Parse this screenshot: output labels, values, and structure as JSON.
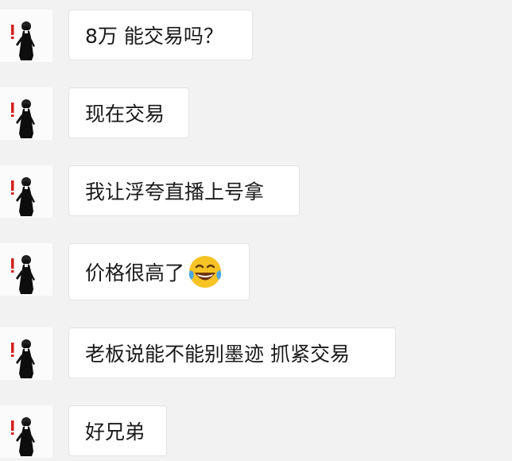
{
  "chat": {
    "messages": [
      {
        "text": "8万 能交易吗？",
        "avatar_icon": "black-robed-figure-icon"
      },
      {
        "text": "现在交易",
        "avatar_icon": "black-robed-figure-icon"
      },
      {
        "text": "我让浮夸直播上号拿",
        "avatar_icon": "black-robed-figure-icon"
      },
      {
        "text": "价格很高了",
        "avatar_icon": "black-robed-figure-icon",
        "emoji": "tears-of-joy-emoji"
      },
      {
        "text": "老板说能不能别墨迹 抓紧交易",
        "avatar_icon": "black-robed-figure-icon"
      },
      {
        "text": "好兄弟",
        "avatar_icon": "black-robed-figure-icon"
      }
    ]
  },
  "colors": {
    "background": "#f2f2f2",
    "bubble": "#ffffff",
    "bubble_border": "#e3e3e3",
    "text": "#1a1a1a",
    "avatar_accent": "#d32020"
  }
}
